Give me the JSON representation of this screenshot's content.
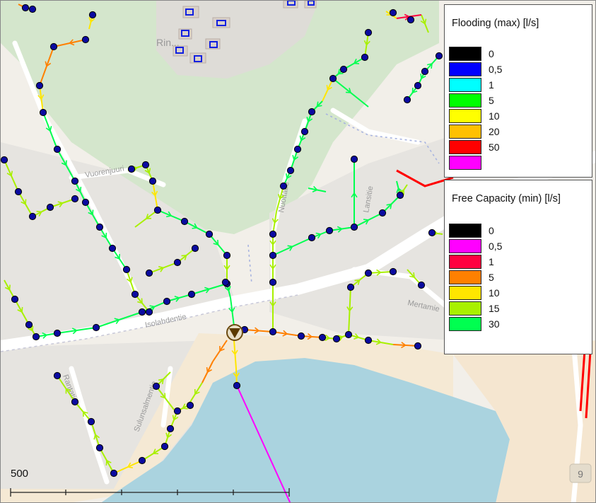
{
  "map": {
    "scale_label": "500",
    "street_names": [
      "Vuorenjuuri",
      "Isolahdentie",
      "Nuottatie",
      "Lansitie",
      "Mertamie",
      "Rantatie",
      "Sulunsalmentie",
      "Rin..."
    ],
    "highway_shield": "9"
  },
  "legend_flooding": {
    "title": "Flooding (max) [l/s]",
    "entries": [
      {
        "label": "0",
        "color": "#000000"
      },
      {
        "label": "0,5",
        "color": "#0000ff"
      },
      {
        "label": "1",
        "color": "#00ffff"
      },
      {
        "label": "5",
        "color": "#00ff00"
      },
      {
        "label": "10",
        "color": "#ffff00"
      },
      {
        "label": "20",
        "color": "#ffc000"
      },
      {
        "label": "50",
        "color": "#ff0000"
      },
      {
        "label": "",
        "color": "#ff00ff"
      }
    ]
  },
  "legend_capacity": {
    "title": "Free Capacity (min) [l/s]",
    "entries": [
      {
        "label": "0",
        "color": "#000000"
      },
      {
        "label": "0,5",
        "color": "#ff00ff"
      },
      {
        "label": "1",
        "color": "#ff0040"
      },
      {
        "label": "5",
        "color": "#ff8000"
      },
      {
        "label": "10",
        "color": "#ffe600"
      },
      {
        "label": "15",
        "color": "#a8f000"
      },
      {
        "label": "30",
        "color": "#00ff50"
      }
    ]
  },
  "colors": {
    "water": "#aad3df",
    "forest": "#d4e6cc",
    "land": "#f2efe9",
    "sand": "#f5e9d4",
    "road": "#ffffff",
    "node": "#0a0aa0",
    "outlet_line": "#ff00ff"
  }
}
